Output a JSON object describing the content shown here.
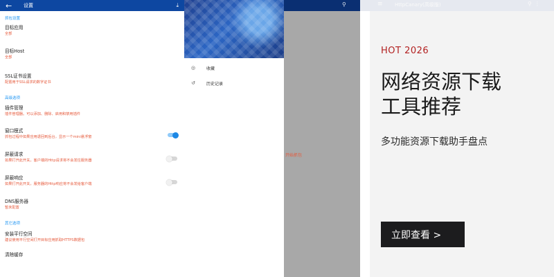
{
  "settings": {
    "title": "设置",
    "sections": [
      {
        "header": "抓包设置",
        "rows": [
          {
            "title": "目标应用",
            "subtitle": "全部"
          },
          {
            "title": "目标Host",
            "subtitle": "全部"
          },
          {
            "title": "SSL证书设置",
            "subtitle": "配置用于SSL请求的数字证书"
          }
        ]
      },
      {
        "header": "高级选项",
        "rows": [
          {
            "title": "插件管理",
            "subtitle": "插件管理器。可以添加、删除、启用和禁用插件"
          },
          {
            "title": "窗口模式",
            "subtitle": "抓包过程中如果应用退回到后台，显示一个mini悬浮窗",
            "toggle": "on"
          },
          {
            "title": "屏蔽请求",
            "subtitle": "如果打开此开关，客户端的Http请求将不会发往服务器",
            "toggle": "off"
          },
          {
            "title": "屏蔽响应",
            "subtitle": "如果打开此开关，服务器的Http响应将不会发给客户端",
            "toggle": "off"
          },
          {
            "title": "DNS服务器",
            "subtitle": "暂未配置"
          }
        ]
      },
      {
        "header": "其它选项",
        "rows": [
          {
            "title": "安装平行空间",
            "subtitle": "建议使用平行空间打开目标应用抓取HTTPS数据包"
          },
          {
            "title": "清除缓存",
            "subtitle": ""
          }
        ]
      }
    ]
  },
  "drawer": {
    "items": [
      {
        "label": "收藏",
        "icon": "favorites-icon"
      },
      {
        "label": "历史记录",
        "icon": "history-icon"
      }
    ],
    "partial_text": "开始抓包"
  },
  "card": {
    "app_title": "HttpCanary(高级版)",
    "tag": "HOT 2026",
    "headline": "网络资源下载工具推荐",
    "subtitle": "多功能资源下载助手盘点",
    "cta_label": "立即查看 >"
  }
}
